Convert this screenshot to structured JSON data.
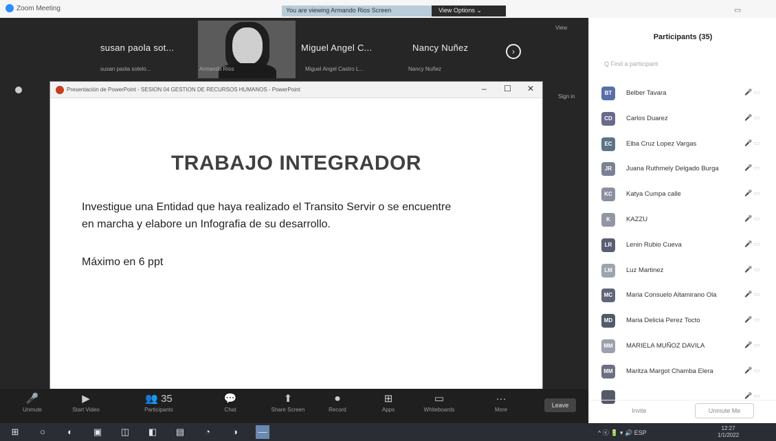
{
  "window": {
    "app_title": "Zoom Meeting",
    "share_banner": "You are viewing Armando Rios Screen",
    "view_options": "View Options ⌄",
    "minimize_glyph": "▭"
  },
  "filmstrip": {
    "tiles": [
      {
        "name": "susan paola sot...",
        "sub": "susan paola sotelo..."
      },
      {
        "name": "",
        "sub": "Armando Rios"
      },
      {
        "name": "Miguel Angel C...",
        "sub": "Miguel Angel Castro L..."
      },
      {
        "name": "Nancy Nuñez",
        "sub": "Nancy Nuñez"
      }
    ],
    "next_glyph": "›",
    "view_label": "View",
    "sign_label": "Sign in"
  },
  "ppt": {
    "window_title": "Presentación de PowerPoint - SESION 04 GESTION DE RECURSOS HUMANOS - PowerPoint",
    "minimize": "–",
    "maximize": "☐",
    "close": "✕",
    "slide": {
      "title": "TRABAJO INTEGRADOR",
      "body_line1": "Investigue una Entidad que haya realizado el Transito Servir o se encuentre",
      "body_line2": "en marcha y elabore un Infografia de su desarrollo.",
      "note": "Máximo en 6 ppt"
    }
  },
  "toolbar": {
    "items": [
      {
        "icon": "mic",
        "glyph": "🎤",
        "label": "Unmute"
      },
      {
        "icon": "video",
        "glyph": "▶",
        "label": "Start Video"
      },
      {
        "icon": "participants",
        "glyph": "👥 35",
        "label": "Participants"
      },
      {
        "icon": "chat",
        "glyph": "💬",
        "label": "Chat"
      },
      {
        "icon": "share",
        "glyph": "⬆",
        "label": "Share Screen"
      },
      {
        "icon": "record",
        "glyph": "⏺",
        "label": "Record"
      },
      {
        "icon": "apps",
        "glyph": "⊞",
        "label": "Apps"
      },
      {
        "icon": "whiteboard",
        "glyph": "▭",
        "label": "Whiteboards"
      },
      {
        "icon": "more",
        "glyph": "···",
        "label": "More"
      }
    ],
    "leave": "Leave"
  },
  "participants": {
    "title": "Participants (35)",
    "search_placeholder": "Q Find a participant",
    "list": [
      {
        "initials": "BT",
        "name": "Belber Tavara",
        "color": "#5a6fa8"
      },
      {
        "initials": "CD",
        "name": "Carlos Duarez",
        "color": "#6a6a8e"
      },
      {
        "initials": "EC",
        "name": "Elba Cruz Lopez Vargas",
        "color": "#5c7488"
      },
      {
        "initials": "JR",
        "name": "Juana Ruthmely Delgado Burga",
        "color": "#7a8194"
      },
      {
        "initials": "KC",
        "name": "Katya Cumpa calle",
        "color": "#8a8fa2"
      },
      {
        "initials": "K",
        "name": "KAZZU",
        "color": "#9296a4"
      },
      {
        "initials": "LR",
        "name": "Lenin Rubio Cueva",
        "color": "#595f70"
      },
      {
        "initials": "LM",
        "name": "Luz Martinez",
        "color": "#9ea3b0"
      },
      {
        "initials": "MC",
        "name": "Maria Consuelo Altamirano Ola",
        "color": "#61677a"
      },
      {
        "initials": "MD",
        "name": "Maria Delicia Perez Tocto",
        "color": "#535a6c"
      },
      {
        "initials": "MM",
        "name": "MARIELA MUÑOZ DAVILA",
        "color": "#9aa0ad"
      },
      {
        "initials": "MM",
        "name": "Maritza Margot Chamba Elera",
        "color": "#6b7181"
      },
      {
        "initials": "",
        "name": "",
        "color": "#555a66"
      }
    ],
    "row_icons": "🎤 ▭",
    "invite": "Invite",
    "unmute_me": "Unmute Me"
  },
  "taskbar": {
    "icons": [
      {
        "name": "start",
        "glyph": "⊞"
      },
      {
        "name": "search",
        "glyph": "○"
      },
      {
        "name": "edge",
        "glyph": "◐"
      },
      {
        "name": "explorer",
        "glyph": "▣"
      },
      {
        "name": "app5",
        "glyph": "◫"
      },
      {
        "name": "app6",
        "glyph": "◧"
      },
      {
        "name": "app7",
        "glyph": "▤"
      },
      {
        "name": "chrome",
        "glyph": "◔"
      },
      {
        "name": "app9",
        "glyph": "◑"
      },
      {
        "name": "zoom",
        "glyph": "—"
      }
    ],
    "tray": "^ ⓔ 🔋 ▾ 🔊 ESP",
    "time": "12:27",
    "date": "1/1/2022"
  }
}
